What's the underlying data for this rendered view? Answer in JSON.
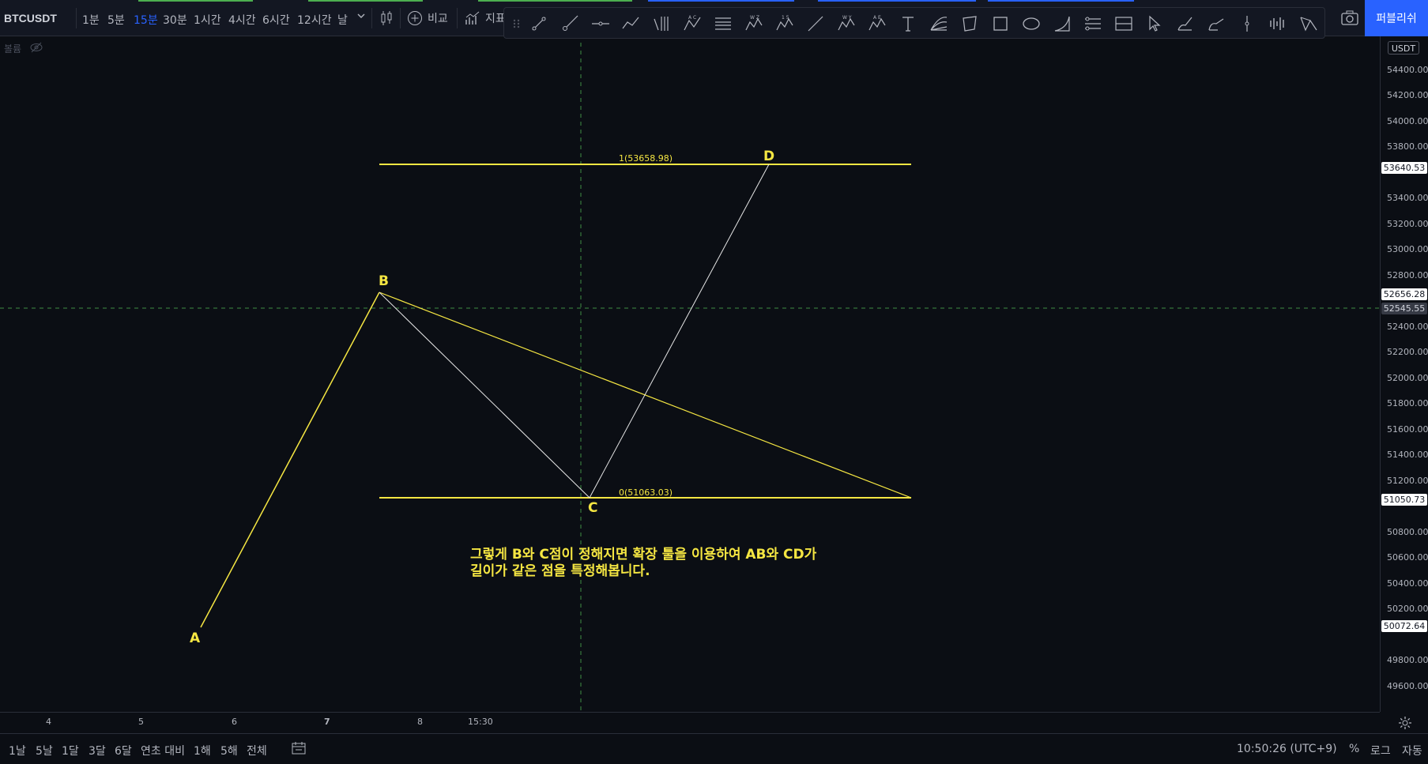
{
  "symbol": "BTCUSDT",
  "timeframes": [
    "1분",
    "5분",
    "15분",
    "30분",
    "1시간",
    "4시간",
    "6시간",
    "12시간",
    "날"
  ],
  "active_timeframe_index": 2,
  "toolbar": {
    "compare_label": "비교",
    "indicators_label": "지표"
  },
  "publish_label": "퍼블리쉬",
  "volume_label": "볼륨",
  "price_axis": {
    "currency_badge": "USDT",
    "ticks": [
      "54400.00",
      "54200.00",
      "54000.00",
      "53800.00",
      "53400.00",
      "53200.00",
      "53000.00",
      "52800.00",
      "52400.00",
      "52200.00",
      "52000.00",
      "51800.00",
      "51600.00",
      "51400.00",
      "51200.00",
      "50800.00",
      "50600.00",
      "50400.00",
      "50200.00",
      "49800.00",
      "49600.00"
    ],
    "tags": {
      "d_level": "53640.53",
      "b_level": "52656.28",
      "crosshair": "52545.55",
      "c_level": "51050.73",
      "a_level": "50072.64"
    }
  },
  "time_axis": [
    "4",
    "5",
    "6",
    "7",
    "8",
    "15:30"
  ],
  "drawing": {
    "points": {
      "a": "A",
      "b": "B",
      "c": "C",
      "d": "D"
    },
    "level_top": "1(53658.98)",
    "level_bottom": "0(51063.03)",
    "annotation_line1": "그렇게 B와 C점이 정해지면 확장 툴을 이용하여 AB와 CD가",
    "annotation_line2": "길이가 같은 점을 특정해봅니다."
  },
  "range_buttons": [
    "1날",
    "5날",
    "1달",
    "3달",
    "6달",
    "연초 대비",
    "1해",
    "5해",
    "전체"
  ],
  "bottom_right": {
    "clock": "10:50:26 (UTC+9)",
    "percent": "%",
    "log": "로그",
    "auto": "자동"
  },
  "colors": {
    "accent": "#2962ff",
    "drawing_yellow": "#f5e642",
    "background": "#0b0e14",
    "crosshair": "#4caf50"
  }
}
